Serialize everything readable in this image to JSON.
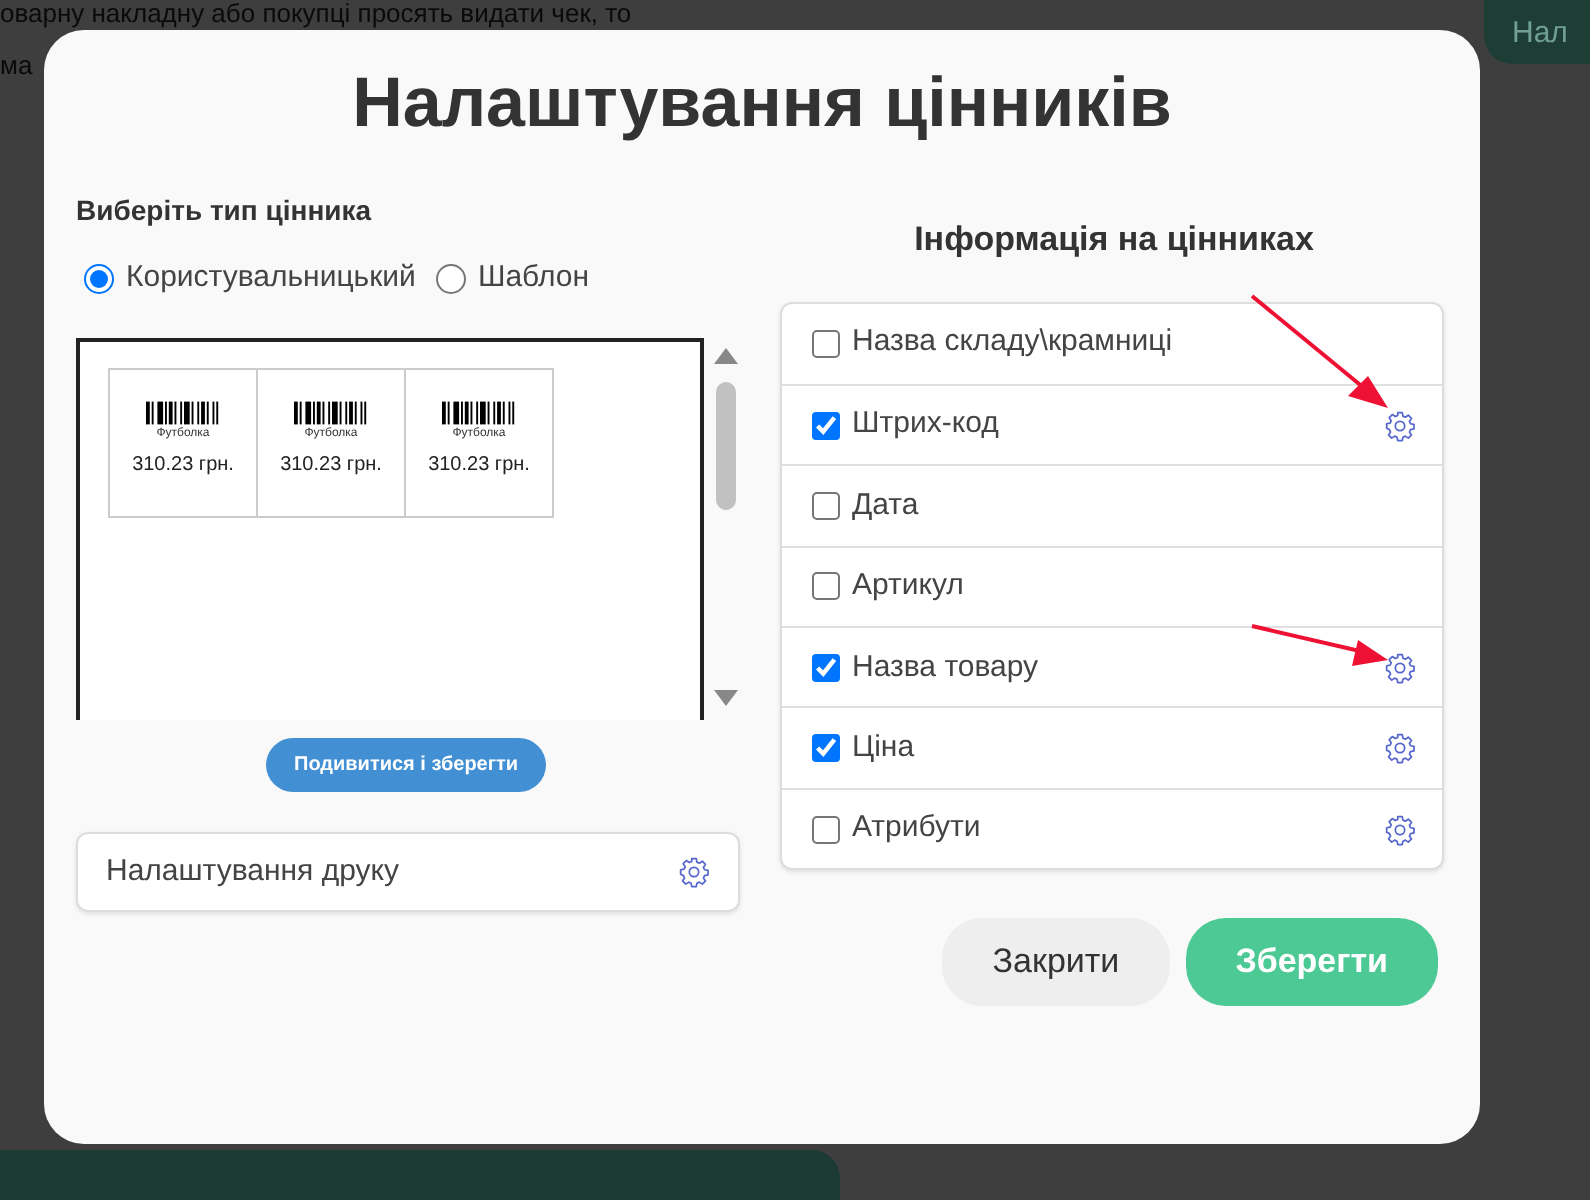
{
  "background": {
    "text_line_1": "оварну накладну або покупці просять видати чек, то",
    "text_line_2": "ма",
    "corner_button": "Нал"
  },
  "dialog": {
    "title": "Налаштування цінників",
    "type_label": "Виберіть тип цінника",
    "type_options": [
      {
        "label": "Користувальницький",
        "selected": true
      },
      {
        "label": "Шаблон",
        "selected": false
      }
    ],
    "preview_labels": [
      {
        "name": "Футболка",
        "price": "310.23 грн."
      },
      {
        "name": "Футболка",
        "price": "310.23 грн."
      },
      {
        "name": "Футболка",
        "price": "310.23 грн."
      }
    ],
    "preview_button": "Подивитися і зберегти",
    "print_settings": "Налаштування друку",
    "info_title": "Інформація на цінниках",
    "info_items": [
      {
        "label": "Назва складу\\крамниці",
        "checked": false,
        "settings": false,
        "annotated": false
      },
      {
        "label": "Штрих-код",
        "checked": true,
        "settings": true,
        "annotated": true
      },
      {
        "label": "Дата",
        "checked": false,
        "settings": false,
        "annotated": false
      },
      {
        "label": "Артикул",
        "checked": false,
        "settings": false,
        "annotated": false
      },
      {
        "label": "Назва товару",
        "checked": true,
        "settings": true,
        "annotated": true
      },
      {
        "label": "Ціна",
        "checked": true,
        "settings": true,
        "annotated": false
      },
      {
        "label": "Атрибути",
        "checked": false,
        "settings": true,
        "annotated": false
      }
    ],
    "buttons": [
      {
        "label": "Закрити",
        "kind": "secondary"
      },
      {
        "label": "Зберегти",
        "kind": "primary"
      }
    ]
  }
}
